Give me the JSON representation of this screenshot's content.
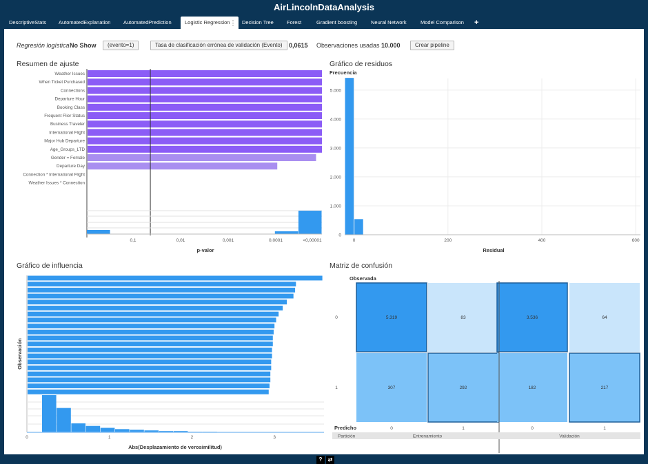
{
  "app": {
    "title": "AirLincolnDataAnalysis"
  },
  "tabs": [
    {
      "label": "DescriptiveStats"
    },
    {
      "label": "AutomatedExplanation"
    },
    {
      "label": "AutomatedPrediction"
    },
    {
      "label": "Logistic Regression",
      "active": true
    },
    {
      "label": "Decision Tree"
    },
    {
      "label": "Forest"
    },
    {
      "label": "Gradient boosting"
    },
    {
      "label": "Neural Network"
    },
    {
      "label": "Model Comparison"
    }
  ],
  "tab_menu_icon": "⋮",
  "add_tab_icon": "+",
  "toolbar": {
    "model_label": "Regresión logística",
    "target": "No Show",
    "event_button": "(evento=1)",
    "metric_button": "Tasa de clasificación errónea de validación (Evento)",
    "metric_value": "0,0615",
    "obs_label": "Observaciones usadas",
    "obs_value": "10.000",
    "pipeline_button": "Crear pipeline"
  },
  "colors": {
    "purple": "#8b5cf6",
    "purple_light": "#a98ef0",
    "blue": "#3399ef",
    "blue_mid": "#7cc2f8",
    "blue_light": "#c9e5fb",
    "tab_bar": "#0b3556"
  },
  "panels": {
    "fit_summary": {
      "title": "Resumen de ajuste"
    },
    "residuals": {
      "title": "Gráfico de residuos"
    },
    "influence": {
      "title": "Gráfico de influencia"
    },
    "confusion": {
      "title": "Matriz de confusión"
    }
  },
  "chart_data": [
    {
      "type": "bar",
      "title": "Resumen de ajuste",
      "xlabel": "p-valor",
      "x_ticks": [
        "0,1",
        "0,01",
        "0,001",
        "0,0001",
        "<0,00001"
      ],
      "categories": [
        "Weather Issues",
        "When Ticket Purchased",
        "Connections",
        "Departure Hour",
        "Booking Class",
        "Frequent Flier Status",
        "Business Traveler",
        "International Flight",
        "Major Hub Departure",
        "Age_Groups_LTD",
        "Gender = Female",
        "Departure Day",
        "Connection * International Flight",
        "Weather Issues * Connection"
      ],
      "values": [
        100,
        100,
        100,
        100,
        100,
        100,
        100,
        100,
        100,
        100,
        97.5,
        81,
        0,
        0
      ],
      "reference_line_value": 27,
      "histogram": {
        "bins": 10,
        "values": [
          6,
          0,
          0,
          0,
          0,
          0,
          0,
          0,
          4,
          34
        ]
      }
    },
    {
      "type": "bar",
      "title": "Gráfico de residuos",
      "ylabel": "Frecuencia",
      "xlabel": "Residual",
      "x_ticks": [
        "0",
        "200",
        "400",
        "600"
      ],
      "y_ticks": [
        "0",
        "1.000",
        "2.000",
        "3.000",
        "4.000",
        "5.000"
      ],
      "xlim": [
        -20,
        610
      ],
      "ylim": [
        0,
        5400
      ],
      "bins": [
        {
          "x0": -20,
          "x1": 0,
          "value": 5420
        },
        {
          "x0": 0,
          "x1": 20,
          "value": 540
        }
      ]
    },
    {
      "type": "bar",
      "title": "Gráfico de influencia",
      "ylabel": "Observación",
      "xlabel": "Abs(Desplazamiento de verosimilitud)",
      "x_ticks": [
        "0",
        "1",
        "2",
        "3"
      ],
      "xlim": [
        0,
        3.6
      ],
      "values": [
        3.58,
        3.26,
        3.25,
        3.23,
        3.15,
        3.1,
        3.05,
        3.02,
        3.0,
        2.99,
        2.98,
        2.98,
        2.97,
        2.97,
        2.96,
        2.96,
        2.95,
        2.95,
        2.94,
        2.93
      ],
      "histogram": {
        "bins": 12,
        "values": [
          58,
          38,
          14,
          10,
          7,
          5,
          4,
          3,
          2,
          2,
          1,
          1
        ]
      }
    },
    {
      "type": "heatmap",
      "title": "Matriz de confusión",
      "ylabel": "Observada",
      "xlabel": "Predicho",
      "partition_label": "Partición",
      "partitions": [
        "Entrenamiento",
        "Validación"
      ],
      "row_labels": [
        "0",
        "1"
      ],
      "col_labels": [
        "0",
        "1"
      ],
      "cells": [
        {
          "partition": "Entrenamiento",
          "row": "0",
          "col": "0",
          "value": "5.319",
          "shade": "dark"
        },
        {
          "partition": "Entrenamiento",
          "row": "0",
          "col": "1",
          "value": "83",
          "shade": "light"
        },
        {
          "partition": "Entrenamiento",
          "row": "1",
          "col": "0",
          "value": "307",
          "shade": "mid"
        },
        {
          "partition": "Entrenamiento",
          "row": "1",
          "col": "1",
          "value": "292",
          "shade": "mid"
        },
        {
          "partition": "Validación",
          "row": "0",
          "col": "0",
          "value": "3.536",
          "shade": "dark"
        },
        {
          "partition": "Validación",
          "row": "0",
          "col": "1",
          "value": "64",
          "shade": "light"
        },
        {
          "partition": "Validación",
          "row": "1",
          "col": "0",
          "value": "182",
          "shade": "mid"
        },
        {
          "partition": "Validación",
          "row": "1",
          "col": "1",
          "value": "217",
          "shade": "mid"
        }
      ]
    }
  ],
  "footer": {
    "help_icon": "?",
    "toggle_icon": "⇄"
  }
}
